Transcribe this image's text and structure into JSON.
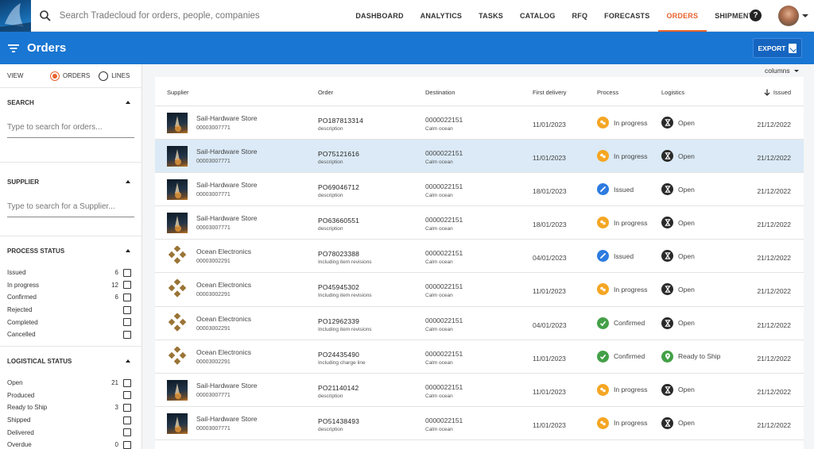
{
  "search": {
    "placeholder": "Search Tradecloud for orders, people, companies"
  },
  "nav": {
    "items": [
      "DASHBOARD",
      "ANALYTICS",
      "TASKS",
      "CATALOG",
      "RFQ",
      "FORECASTS",
      "ORDERS",
      "SHIPMENTS"
    ],
    "active": "ORDERS",
    "help_label": "?"
  },
  "header": {
    "title": "Orders",
    "export_label": "EXPORT"
  },
  "sidebar": {
    "view_label": "VIEW",
    "view_options": [
      "ORDERS",
      "LINES"
    ],
    "view_selected": "ORDERS",
    "search": {
      "title": "SEARCH",
      "placeholder": "Type to search for orders..."
    },
    "supplier": {
      "title": "SUPPLIER",
      "placeholder": "Type to search for a Supplier..."
    },
    "process_status": {
      "title": "PROCESS STATUS",
      "items": [
        {
          "label": "Issued",
          "count": "6"
        },
        {
          "label": "In progress",
          "count": "12"
        },
        {
          "label": "Confirmed",
          "count": "6"
        },
        {
          "label": "Rejected",
          "count": ""
        },
        {
          "label": "Completed",
          "count": ""
        },
        {
          "label": "Cancelled",
          "count": ""
        }
      ]
    },
    "logistical_status": {
      "title": "LOGISTICAL STATUS",
      "items": [
        {
          "label": "Open",
          "count": "21"
        },
        {
          "label": "Produced",
          "count": ""
        },
        {
          "label": "Ready to Ship",
          "count": "3"
        },
        {
          "label": "Shipped",
          "count": ""
        },
        {
          "label": "Delivered",
          "count": ""
        },
        {
          "label": "Overdue",
          "count": "0"
        }
      ]
    }
  },
  "table": {
    "columns_label": "columns",
    "headers": {
      "supplier": "Supplier",
      "order": "Order",
      "destination": "Destination",
      "first_delivery": "First delivery",
      "process": "Process",
      "logistics": "Logistics",
      "issued": "Issued"
    },
    "rows": [
      {
        "supplier": "Sail-Hardware Store",
        "code": "00003007771",
        "type": "store",
        "order": "PO187813314",
        "desc": "description",
        "dest": "0000022151",
        "dest_name": "Calm ocean",
        "delivery": "11/01/2023",
        "process": "In progress",
        "logistics": "Open",
        "issued": "21/12/2022",
        "selected": false
      },
      {
        "supplier": "Sail-Hardware Store",
        "code": "00003007771",
        "type": "store",
        "order": "PO75121616",
        "desc": "description",
        "dest": "0000022151",
        "dest_name": "Calm ocean",
        "delivery": "11/01/2023",
        "process": "In progress",
        "logistics": "Open",
        "issued": "21/12/2022",
        "selected": true
      },
      {
        "supplier": "Sail-Hardware Store",
        "code": "00003007771",
        "type": "store",
        "order": "PO69046712",
        "desc": "description",
        "dest": "0000022151",
        "dest_name": "Calm ocean",
        "delivery": "18/01/2023",
        "process": "Issued",
        "logistics": "Open",
        "issued": "21/12/2022",
        "selected": false
      },
      {
        "supplier": "Sail-Hardware Store",
        "code": "00003007771",
        "type": "store",
        "order": "PO63660551",
        "desc": "description",
        "dest": "0000022151",
        "dest_name": "Calm ocean",
        "delivery": "18/01/2023",
        "process": "In progress",
        "logistics": "Open",
        "issued": "21/12/2022",
        "selected": false
      },
      {
        "supplier": "Ocean Electronics",
        "code": "00003002291",
        "type": "elec",
        "order": "PO78023388",
        "desc": "Including item revisions",
        "dest": "0000022151",
        "dest_name": "Calm ocean",
        "delivery": "04/01/2023",
        "process": "Issued",
        "logistics": "Open",
        "issued": "21/12/2022",
        "selected": false
      },
      {
        "supplier": "Ocean Electronics",
        "code": "00003002291",
        "type": "elec",
        "order": "PO45945302",
        "desc": "Including item revisions",
        "dest": "0000022151",
        "dest_name": "Calm ocean",
        "delivery": "11/01/2023",
        "process": "In progress",
        "logistics": "Open",
        "issued": "21/12/2022",
        "selected": false
      },
      {
        "supplier": "Ocean Electronics",
        "code": "00003002291",
        "type": "elec",
        "order": "PO12962339",
        "desc": "Including item revisions",
        "dest": "0000022151",
        "dest_name": "Calm ocean",
        "delivery": "04/01/2023",
        "process": "Confirmed",
        "logistics": "Open",
        "issued": "21/12/2022",
        "selected": false
      },
      {
        "supplier": "Ocean Electronics",
        "code": "00003002291",
        "type": "elec",
        "order": "PO24435490",
        "desc": "Including charge line",
        "dest": "0000022151",
        "dest_name": "Calm ocean",
        "delivery": "11/01/2023",
        "process": "Confirmed",
        "logistics": "Ready to Ship",
        "issued": "21/12/2022",
        "selected": false
      },
      {
        "supplier": "Sail-Hardware Store",
        "code": "00003007771",
        "type": "store",
        "order": "PO21140142",
        "desc": "description",
        "dest": "0000022151",
        "dest_name": "Calm ocean",
        "delivery": "11/01/2023",
        "process": "In progress",
        "logistics": "Open",
        "issued": "21/12/2022",
        "selected": false
      },
      {
        "supplier": "Sail-Hardware Store",
        "code": "00003007771",
        "type": "store",
        "order": "PO51438493",
        "desc": "description",
        "dest": "0000022151",
        "dest_name": "Calm ocean",
        "delivery": "11/01/2023",
        "process": "In progress",
        "logistics": "Open",
        "issued": "21/12/2022",
        "selected": false
      }
    ]
  },
  "colors": {
    "accent": "#e8622c",
    "primary": "#1976d2",
    "in_progress": "#f5a623",
    "issued": "#2d7be0",
    "confirmed": "#43a047",
    "open": "#2a2a2a",
    "ready": "#43a047",
    "selected_row": "#dbeaf6"
  }
}
